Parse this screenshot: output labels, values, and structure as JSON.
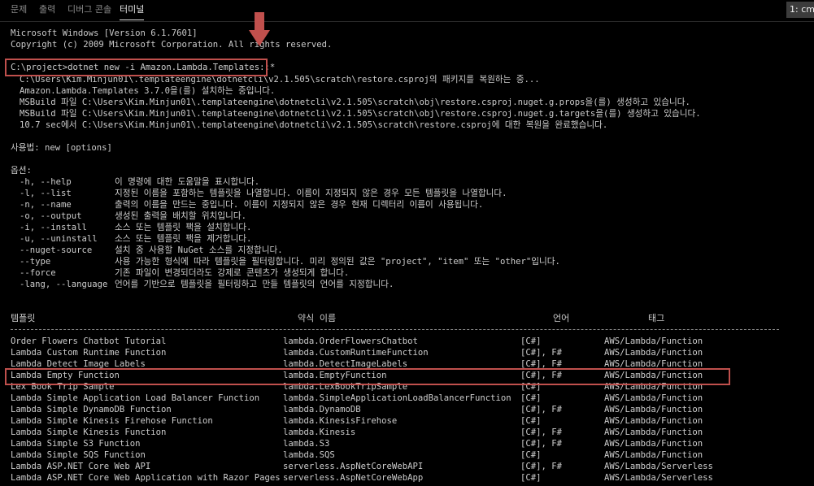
{
  "tabs": [
    {
      "label": "문제"
    },
    {
      "label": "출력"
    },
    {
      "label": "디버그 콘솔"
    },
    {
      "label": "터미널"
    }
  ],
  "terminal_selector": "1: cm",
  "header_lines": [
    "Microsoft Windows [Version 6.1.7601]",
    "Copyright (c) 2009 Microsoft Corporation. All rights reserved."
  ],
  "command": "C:\\project>dotnet new -i Amazon.Lambda.Templates::*",
  "restore_lines": [
    "C:\\Users\\Kim.Minjun01\\.templateengine\\dotnetcli\\v2.1.505\\scratch\\restore.csproj의 패키지를 복원하는 중...",
    "Amazon.Lambda.Templates 3.7.0을(를) 설치하는 중입니다.",
    "MSBuild 파일 C:\\Users\\Kim.Minjun01\\.templateengine\\dotnetcli\\v2.1.505\\scratch\\obj\\restore.csproj.nuget.g.props을(를) 생성하고 있습니다.",
    "MSBuild 파일 C:\\Users\\Kim.Minjun01\\.templateengine\\dotnetcli\\v2.1.505\\scratch\\obj\\restore.csproj.nuget.g.targets을(를) 생성하고 있습니다.",
    "10.7 sec에서 C:\\Users\\Kim.Minjun01\\.templateengine\\dotnetcli\\v2.1.505\\scratch\\restore.csproj에 대한 복원을 완료했습니다."
  ],
  "usage": "사용법: new [options]",
  "options_title": "옵션:",
  "options": [
    {
      "flag": "-h, --help",
      "desc": "이 명령에 대한 도움말을 표시합니다."
    },
    {
      "flag": "-l, --list",
      "desc": "지정된 이름을 포함하는 템플릿을 나열합니다. 이름이 지정되지 않은 경우 모든 템플릿을 나열합니다."
    },
    {
      "flag": "-n, --name",
      "desc": "출력의 이름을 만드는 중입니다. 이름이 지정되지 않은 경우 현재 디렉터리 이름이 사용됩니다."
    },
    {
      "flag": "-o, --output",
      "desc": "생성된 출력을 배치할 위치입니다."
    },
    {
      "flag": "-i, --install",
      "desc": "소스 또는 템플릿 팩을 설치합니다."
    },
    {
      "flag": "-u, --uninstall",
      "desc": "소스 또는 템플릿 팩을 제거합니다."
    },
    {
      "flag": "--nuget-source",
      "desc": "설치 중 사용할 NuGet 소스를 지정합니다."
    },
    {
      "flag": "--type",
      "desc": "사용 가능한 형식에 따라 템플릿을 필터링합니다. 미리 정의된 값은 \"project\", \"item\" 또는 \"other\"입니다."
    },
    {
      "flag": "--force",
      "desc": "기존 파일이 변경되더라도 강제로 콘텐츠가 생성되게 합니다."
    },
    {
      "flag": "-lang, --language",
      "desc": "언어를 기반으로 템플릿을 필터링하고 만들 템플릿의 언어를 지정합니다."
    }
  ],
  "table_headers": {
    "template": "템플릿",
    "short_name": "약식 이름",
    "language": "언어",
    "tags": "태그"
  },
  "templates": [
    {
      "name": "Order Flowers Chatbot Tutorial",
      "short": "lambda.OrderFlowersChatbot",
      "lang": "[C#]",
      "tags": "AWS/Lambda/Function"
    },
    {
      "name": "Lambda Custom Runtime Function",
      "short": "lambda.CustomRuntimeFunction",
      "lang": "[C#], F#",
      "tags": "AWS/Lambda/Function"
    },
    {
      "name": "Lambda Detect Image Labels",
      "short": "lambda.DetectImageLabels",
      "lang": "[C#], F#",
      "tags": "AWS/Lambda/Function"
    },
    {
      "name": "Lambda Empty Function",
      "short": "lambda.EmptyFunction",
      "lang": "[C#], F#",
      "tags": "AWS/Lambda/Function"
    },
    {
      "name": "Lex Book Trip Sample",
      "short": "lambda.LexBookTripSample",
      "lang": "[C#]",
      "tags": "AWS/Lambda/Function"
    },
    {
      "name": "Lambda Simple Application Load Balancer Function",
      "short": "lambda.SimpleApplicationLoadBalancerFunction",
      "lang": "[C#]",
      "tags": "AWS/Lambda/Function"
    },
    {
      "name": "Lambda Simple DynamoDB Function",
      "short": "lambda.DynamoDB",
      "lang": "[C#], F#",
      "tags": "AWS/Lambda/Function"
    },
    {
      "name": "Lambda Simple Kinesis Firehose Function",
      "short": "lambda.KinesisFirehose",
      "lang": "[C#]",
      "tags": "AWS/Lambda/Function"
    },
    {
      "name": "Lambda Simple Kinesis Function",
      "short": "lambda.Kinesis",
      "lang": "[C#], F#",
      "tags": "AWS/Lambda/Function"
    },
    {
      "name": "Lambda Simple S3 Function",
      "short": "lambda.S3",
      "lang": "[C#], F#",
      "tags": "AWS/Lambda/Function"
    },
    {
      "name": "Lambda Simple SQS Function",
      "short": "lambda.SQS",
      "lang": "[C#]",
      "tags": "AWS/Lambda/Function"
    },
    {
      "name": "Lambda ASP.NET Core Web API",
      "short": "serverless.AspNetCoreWebAPI",
      "lang": "[C#], F#",
      "tags": "AWS/Lambda/Serverless"
    },
    {
      "name": "Lambda ASP.NET Core Web Application with Razor Pages",
      "short": "serverless.AspNetCoreWebApp",
      "lang": "[C#]",
      "tags": "AWS/Lambda/Serverless"
    }
  ],
  "colors": {
    "background": "#000000",
    "text": "#cccccc",
    "highlight": "#c0504d",
    "arrow": "#c0504d"
  }
}
